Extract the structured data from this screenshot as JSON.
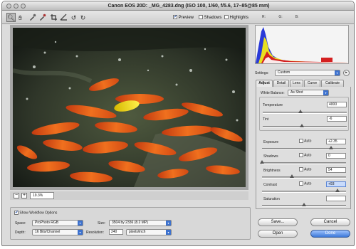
{
  "window": {
    "title": "Canon EOS 20D: _MG_4283.dng (ISO 100, 1/60, f/5.6, 17–85@85 mm)"
  },
  "toolbar": {
    "tool_icons": [
      "zoom-icon",
      "hand-icon",
      "white-balance-icon",
      "color-sampler-icon",
      "crop-icon",
      "straighten-icon",
      "rotate-left-icon",
      "rotate-right-icon"
    ],
    "preview": {
      "label": "Preview",
      "checked": true
    },
    "shadows": {
      "label": "Shadows",
      "checked": false
    },
    "highlights": {
      "label": "Highlights",
      "checked": false
    },
    "rgb": {
      "r": "R:",
      "g": "G:",
      "b": "B:"
    }
  },
  "zoom": {
    "minus": "−",
    "plus": "+",
    "value": "19.3%"
  },
  "workflow": {
    "show_label": "Show Workflow Options",
    "show_checked": true,
    "space_label": "Space:",
    "space_value": "ProPhoto RGB",
    "depth_label": "Depth:",
    "depth_value": "16 Bits/Channel",
    "size_label": "Size:",
    "size_value": "3504 by 2336 (8.2 MP)",
    "resolution_label": "Resolution:",
    "resolution_value": "240",
    "resolution_unit": "pixels/inch"
  },
  "settings": {
    "label": "Settings:",
    "value": "Custom"
  },
  "tabs": [
    "Adjust",
    "Detail",
    "Lens",
    "Curve",
    "Calibrate"
  ],
  "adjust": {
    "white_balance_label": "White Balance:",
    "white_balance_value": "As Shot",
    "temperature_label": "Temperature",
    "temperature_value": "4000",
    "temperature_level": 0.45,
    "tint_label": "Tint",
    "tint_value": "-6",
    "tint_level": 0.47,
    "auto_label": "Auto",
    "exposure_label": "Exposure",
    "exposure_value": "+2.35",
    "exposure_level": 0.82,
    "shadows_label": "Shadows",
    "shadows_value": "0",
    "shadows_level": 0.0,
    "brightness_label": "Brightness",
    "brightness_value": "54",
    "brightness_level": 0.36,
    "contrast_label": "Contrast",
    "contrast_value": "+93",
    "contrast_level": 0.9,
    "saturation_label": "Saturation",
    "saturation_value": "",
    "saturation_level": 0.5
  },
  "buttons": {
    "save": "Save...",
    "cancel": "Cancel",
    "open": "Open",
    "done": "Done"
  },
  "colors": {
    "accent": "#3d72cf",
    "histogram_blue": "#2a3ad8",
    "histogram_yellow": "#e8e020",
    "histogram_red": "#d42020"
  }
}
